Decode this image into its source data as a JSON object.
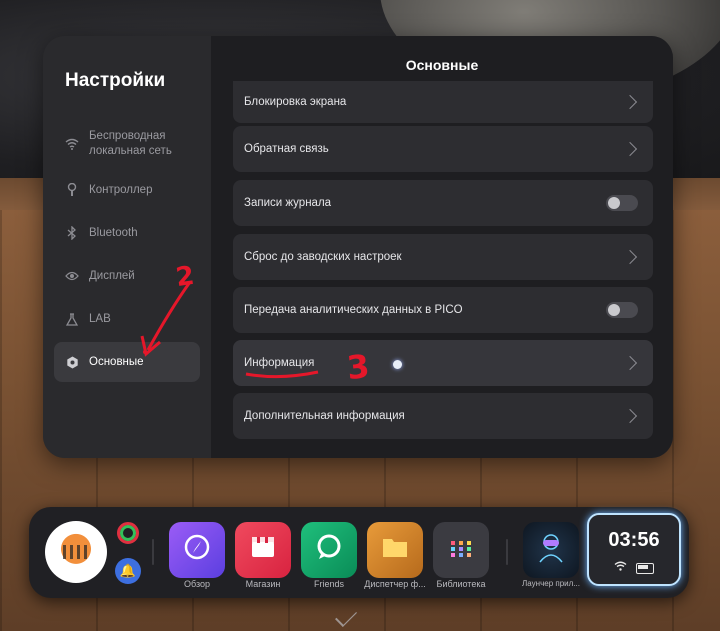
{
  "sidebar": {
    "title": "Настройки",
    "items": [
      {
        "label": "Беспроводная локальная сеть",
        "icon": "wifi-icon"
      },
      {
        "label": "Контроллер",
        "icon": "controller-icon"
      },
      {
        "label": "Bluetooth",
        "icon": "bluetooth-icon"
      },
      {
        "label": "Дисплей",
        "icon": "eye-icon"
      },
      {
        "label": "LAB",
        "icon": "flask-icon"
      },
      {
        "label": "Основные",
        "icon": "gear-icon",
        "active": true
      }
    ]
  },
  "content": {
    "title": "Основные",
    "rows": [
      {
        "label": "Блокировка экрана",
        "control": "chevron"
      },
      {
        "label": "Обратная связь",
        "control": "chevron"
      },
      {
        "label": "Записи журнала",
        "control": "toggle",
        "value": "off"
      },
      {
        "label": "Сброс до заводских настроек",
        "control": "chevron"
      },
      {
        "label": "Передача аналитических данных в PICO",
        "control": "toggle",
        "value": "off"
      },
      {
        "label": "Информация",
        "control": "chevron"
      },
      {
        "label": "Дополнительная информация",
        "control": "chevron"
      }
    ]
  },
  "annotations": {
    "two": "2",
    "three": "3"
  },
  "dock": {
    "apps": [
      {
        "label": "Обзор",
        "icon": "compass-icon",
        "color": "#7b4ff0"
      },
      {
        "label": "Магазин",
        "icon": "store-icon",
        "color": "#e8354d"
      },
      {
        "label": "Friends",
        "icon": "chat-icon",
        "color": "#0fa36a"
      },
      {
        "label": "Диспетчер ф...",
        "icon": "folder-icon",
        "color": "#d98a2a"
      },
      {
        "label": "Библиотека",
        "icon": "grid-icon",
        "color": "#3a3a40"
      },
      {
        "label": "Лаунчер прил...",
        "icon": "vr-headset-icon",
        "color": "#1a2a3a"
      }
    ],
    "clock": {
      "time": "03:56"
    }
  },
  "colors": {
    "annotation": "#e5172a",
    "accent_glow": "#6fb6ff"
  }
}
